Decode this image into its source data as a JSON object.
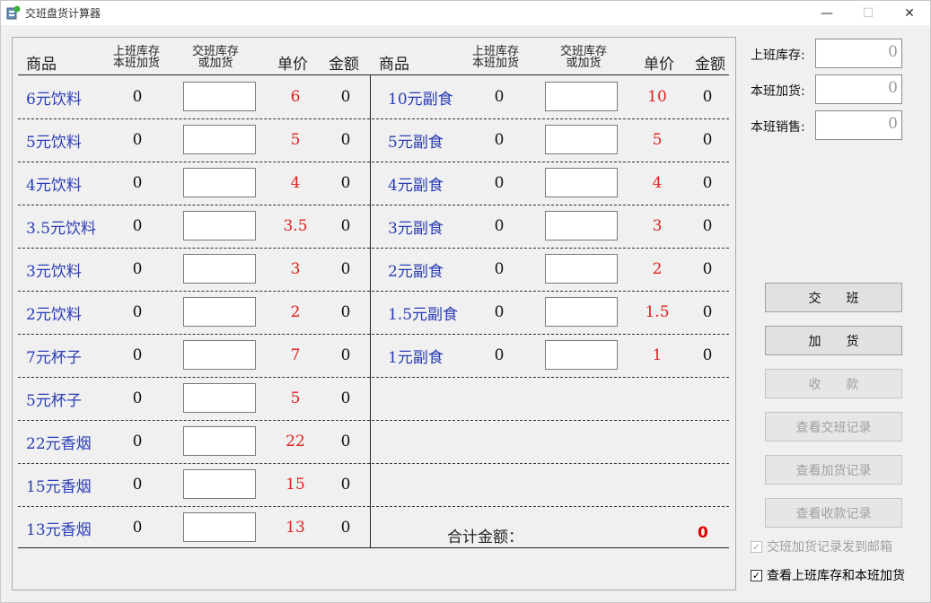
{
  "window": {
    "title": "交班盘货计算器"
  },
  "headers": {
    "product": "商品",
    "prev_stock_1": "上班库存",
    "prev_stock_2": "本班加货",
    "handover_1": "交班库存",
    "handover_2": "或加货",
    "unit_price": "单价",
    "amount": "金额"
  },
  "left_items": [
    {
      "name": "6元饮料",
      "stock": "0",
      "price": "6",
      "amount": "0"
    },
    {
      "name": "5元饮料",
      "stock": "0",
      "price": "5",
      "amount": "0"
    },
    {
      "name": "4元饮料",
      "stock": "0",
      "price": "4",
      "amount": "0"
    },
    {
      "name": "3.5元饮料",
      "stock": "0",
      "price": "3.5",
      "amount": "0"
    },
    {
      "name": "3元饮料",
      "stock": "0",
      "price": "3",
      "amount": "0"
    },
    {
      "name": "2元饮料",
      "stock": "0",
      "price": "2",
      "amount": "0"
    },
    {
      "name": "7元杯子",
      "stock": "0",
      "price": "7",
      "amount": "0"
    },
    {
      "name": "5元杯子",
      "stock": "0",
      "price": "5",
      "amount": "0"
    },
    {
      "name": "22元香烟",
      "stock": "0",
      "price": "22",
      "amount": "0"
    },
    {
      "name": "15元香烟",
      "stock": "0",
      "price": "15",
      "amount": "0"
    },
    {
      "name": "13元香烟",
      "stock": "0",
      "price": "13",
      "amount": "0"
    }
  ],
  "right_items": [
    {
      "name": "10元副食",
      "stock": "0",
      "price": "10",
      "amount": "0"
    },
    {
      "name": "5元副食",
      "stock": "0",
      "price": "5",
      "amount": "0"
    },
    {
      "name": "4元副食",
      "stock": "0",
      "price": "4",
      "amount": "0"
    },
    {
      "name": "3元副食",
      "stock": "0",
      "price": "3",
      "amount": "0"
    },
    {
      "name": "2元副食",
      "stock": "0",
      "price": "2",
      "amount": "0"
    },
    {
      "name": "1.5元副食",
      "stock": "0",
      "price": "1.5",
      "amount": "0"
    },
    {
      "name": "1元副食",
      "stock": "0",
      "price": "1",
      "amount": "0"
    }
  ],
  "total": {
    "label": "合计金额：",
    "value": "0"
  },
  "side": {
    "prev_stock_label": "上班库存:",
    "prev_stock_value": "0",
    "added_label": "本班加货:",
    "added_value": "0",
    "sales_label": "本班销售:",
    "sales_value": "0"
  },
  "buttons": {
    "handover": "交　　班",
    "add_stock": "加　　货",
    "collect": "收　　款",
    "view_handover": "查看交班记录",
    "view_add": "查看加货记录",
    "view_collect": "查看收款记录"
  },
  "checkboxes": {
    "email": "交班加货记录发到邮箱",
    "view_stock": "查看上班库存和本班加货"
  },
  "icons": {
    "minimize": "minimize-icon",
    "maximize": "maximize-icon",
    "close": "close-icon",
    "app": "app-icon"
  }
}
